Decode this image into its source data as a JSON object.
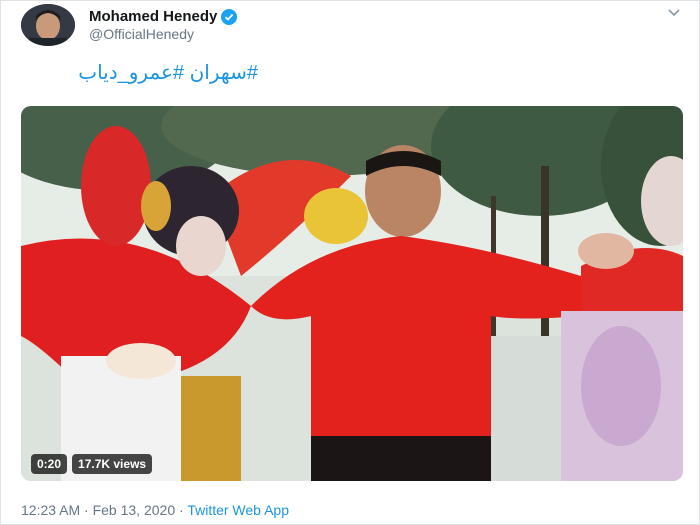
{
  "tweet": {
    "author_name": "Mohamed Henedy",
    "author_handle": "@OfficialHenedy",
    "text": "#سهران #عمرو_دياب",
    "media": {
      "elapsed": "0:20",
      "views": "17.7K views"
    },
    "timestamp": "12:23 AM · Feb 13, 2020",
    "separator": " · ",
    "source_app": "Twitter Web App"
  },
  "colors": {
    "link": "#1b95e0",
    "verified": "#1da1f2",
    "text_primary": "#14171a",
    "text_secondary": "#657786"
  },
  "icons": {
    "verified": "verified-badge-icon",
    "menu": "chevron-down-icon"
  }
}
